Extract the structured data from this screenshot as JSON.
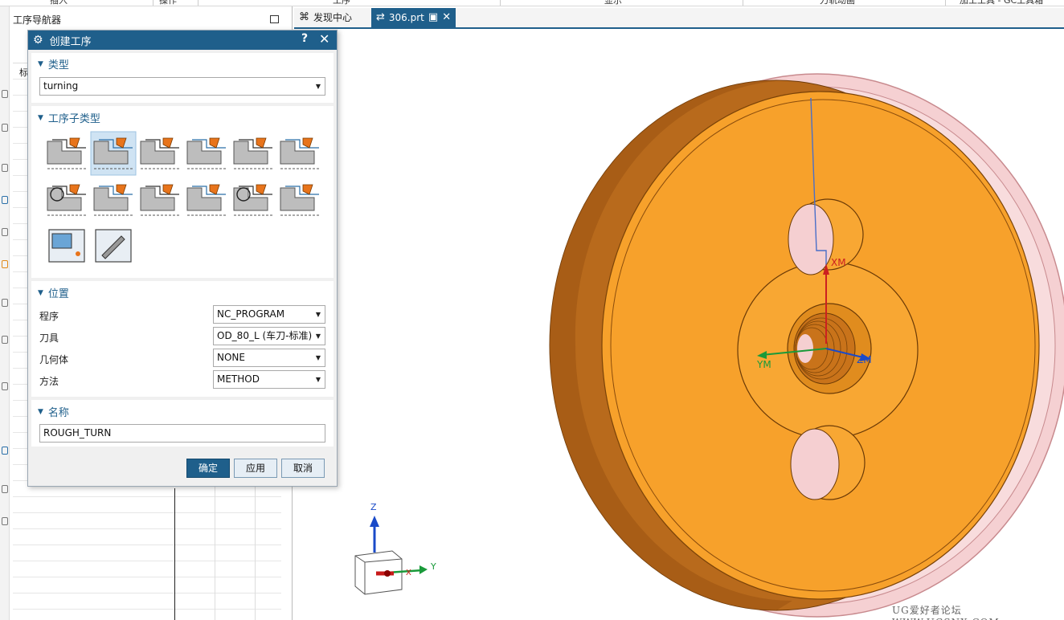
{
  "ribbon": {
    "items": [
      "插入",
      "操作",
      "工序",
      "显示",
      "刀轨动画",
      "加工工具 - GC工具箱"
    ]
  },
  "navigator": {
    "title": "工序导航器",
    "column_header": "标"
  },
  "tabs": [
    {
      "label": "发现中心",
      "icon": "discovery-icon"
    },
    {
      "label": "306.prt",
      "icon": "part-file-icon"
    }
  ],
  "dialog": {
    "title": "创建工序",
    "help": "?",
    "close": "✕",
    "sections": {
      "type": {
        "label": "类型",
        "value": "turning"
      },
      "subtype": {
        "label": "工序子类型",
        "selected_index": 1,
        "icons": [
          "facing-icon",
          "rough-turn-od-icon",
          "rough-back-turn-icon",
          "rough-bore-id-icon",
          "finish-turn-od-icon",
          "groove-od-icon",
          "center-line-drilling-icon",
          "thread-od-icon",
          "teach-mode-icon",
          "teach-mode-id-icon",
          "part-off-icon",
          "center-line-spotdrill-icon",
          "machine-control-icon",
          "user-defined-icon"
        ]
      },
      "location": {
        "label": "位置",
        "fields": [
          {
            "label": "程序",
            "value": "NC_PROGRAM"
          },
          {
            "label": "刀具",
            "value": "OD_80_L (车刀-标准)"
          },
          {
            "label": "几何体",
            "value": "NONE"
          },
          {
            "label": "方法",
            "value": "METHOD"
          }
        ]
      },
      "name": {
        "label": "名称",
        "value": "ROUGH_TURN"
      }
    },
    "buttons": {
      "ok": "确定",
      "apply": "应用",
      "cancel": "取消"
    }
  },
  "viewport": {
    "axes": {
      "xm": "XM",
      "ym": "YM",
      "zm": "ZM"
    },
    "triad": {
      "x": "X",
      "y": "Y",
      "z": "Z"
    },
    "watermark": "UG爱好者论坛 WWW.UGSNX.COM"
  },
  "colors": {
    "accent": "#1f5f8b",
    "part_orange": "#f5a43a",
    "stock_pink": "#f3c7c9"
  }
}
